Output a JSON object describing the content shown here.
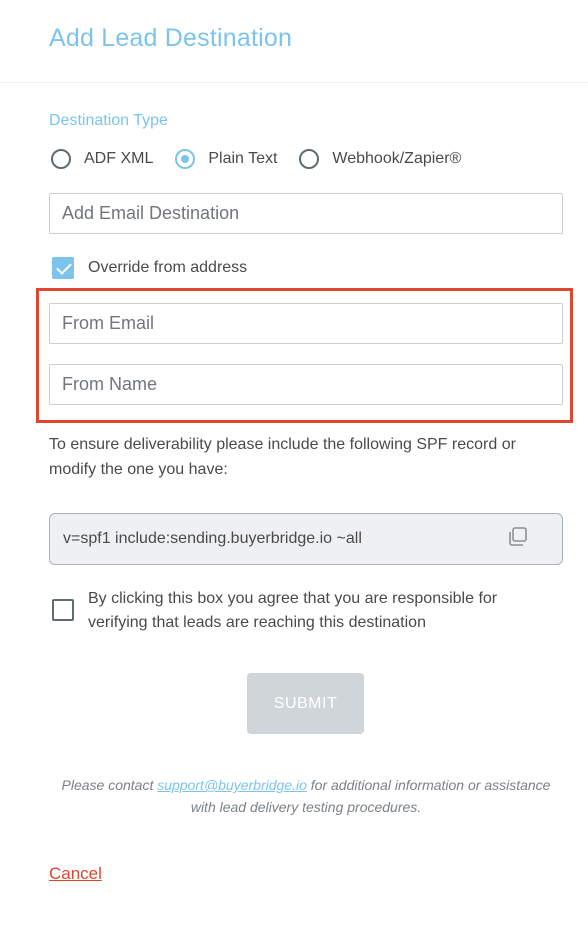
{
  "modal": {
    "title": "Add Lead Destination"
  },
  "destination_type": {
    "label": "Destination Type",
    "options": [
      {
        "label": "ADF XML",
        "checked": false
      },
      {
        "label": "Plain Text",
        "checked": true
      },
      {
        "label": "Webhook/Zapier®",
        "checked": false
      }
    ]
  },
  "email_destination": {
    "placeholder": "Add Email Destination",
    "value": ""
  },
  "override": {
    "label": "Override from address",
    "checked": true
  },
  "from_email": {
    "placeholder": "From Email",
    "value": ""
  },
  "from_name": {
    "placeholder": "From Name",
    "value": ""
  },
  "spf": {
    "instructions": "To ensure deliverability please include the following SPF record or modify the one you have:",
    "record": "v=spf1 include:sending.buyerbridge.io ~all",
    "copy_icon": "copy-icon"
  },
  "agreement": {
    "label": "By clicking this box you agree that you are responsible for verifying that leads are reaching this destination",
    "checked": false
  },
  "submit": {
    "label": "SUBMIT"
  },
  "footer": {
    "before": "Please contact ",
    "link": "support@buyerbridge.io",
    "after": " for additional information or assistance with lead delivery testing procedures."
  },
  "cancel": {
    "label": "Cancel"
  },
  "colors": {
    "accent": "#7cc4ee",
    "highlight": "#e0452f",
    "cancel": "#e0452f"
  }
}
